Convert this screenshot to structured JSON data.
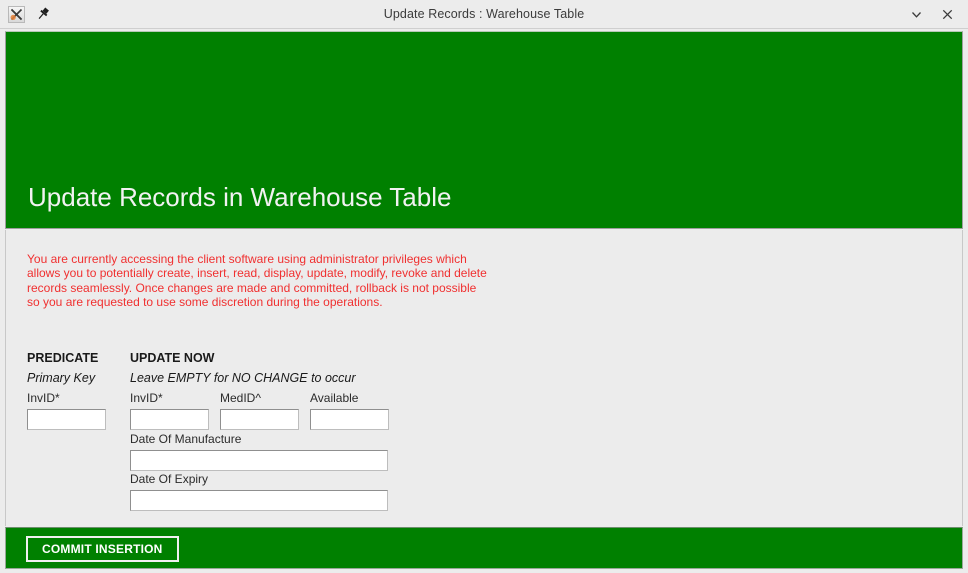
{
  "titlebar": {
    "title": "Update Records : Warehouse Table",
    "app_icon": "app-logo-icon",
    "pin_icon": "pin-icon",
    "minimize_icon": "chevron-down-icon",
    "close_icon": "close-icon"
  },
  "banner": {
    "heading": "Update Records in Warehouse Table",
    "color": "#008000",
    "text_color": "#f2f2f2"
  },
  "content": {
    "warning": "You are currently accessing the client software using administrator privileges which allows you to potentially create, insert, read, display, update, modify, revoke and delete records seamlessly. Once changes are made and committed, rollback is not possible so you are requested to use some discretion during the operations.",
    "warning_color": "#f03030",
    "background": "#ececec"
  },
  "form": {
    "predicate_heading": "PREDICATE",
    "predicate_subheading": "Primary Key",
    "update_heading": "UPDATE NOW",
    "update_subheading": "Leave EMPTY for NO CHANGE to occur",
    "fields": {
      "predicate_invid": {
        "label": "InvID*",
        "value": "",
        "placeholder": ""
      },
      "update_invid": {
        "label": "InvID*",
        "value": "",
        "placeholder": ""
      },
      "update_medid": {
        "label": "MedID^",
        "value": "",
        "placeholder": ""
      },
      "update_available": {
        "label": "Available",
        "value": "",
        "placeholder": ""
      },
      "update_dom": {
        "label": "Date Of Manufacture",
        "value": "",
        "placeholder": ""
      },
      "update_doe": {
        "label": "Date Of Expiry",
        "value": "",
        "placeholder": ""
      }
    }
  },
  "footer": {
    "commit_label": "COMMIT INSERTION",
    "color": "#008000"
  }
}
